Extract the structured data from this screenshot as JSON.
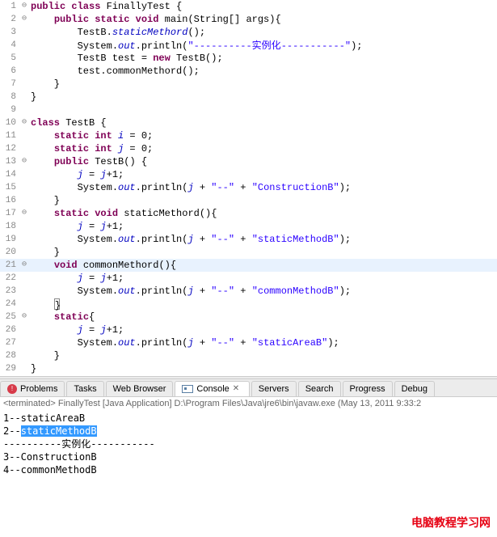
{
  "code": {
    "lines": [
      {
        "n": "1",
        "fold": "⊖",
        "tokens": [
          {
            "t": "kw",
            "v": "public class"
          },
          {
            "t": "",
            "v": " FinallyTest {"
          }
        ]
      },
      {
        "n": "2",
        "fold": "⊖",
        "tokens": [
          {
            "t": "",
            "v": "    "
          },
          {
            "t": "kw",
            "v": "public static void"
          },
          {
            "t": "",
            "v": " main(String[] args){"
          }
        ]
      },
      {
        "n": "3",
        "fold": "",
        "tokens": [
          {
            "t": "",
            "v": "        TestB."
          },
          {
            "t": "fld",
            "v": "staticMethord"
          },
          {
            "t": "",
            "v": "();"
          }
        ]
      },
      {
        "n": "4",
        "fold": "",
        "tokens": [
          {
            "t": "",
            "v": "        System."
          },
          {
            "t": "fld",
            "v": "out"
          },
          {
            "t": "",
            "v": ".println("
          },
          {
            "t": "str",
            "v": "\"----------"
          },
          {
            "t": "str-cn",
            "v": "实例化"
          },
          {
            "t": "str",
            "v": "-----------\""
          },
          {
            "t": "",
            "v": ");"
          }
        ]
      },
      {
        "n": "5",
        "fold": "",
        "tokens": [
          {
            "t": "",
            "v": "        TestB test = "
          },
          {
            "t": "kw",
            "v": "new"
          },
          {
            "t": "",
            "v": " TestB();"
          }
        ]
      },
      {
        "n": "6",
        "fold": "",
        "tokens": [
          {
            "t": "",
            "v": "        test.commonMethord();"
          }
        ]
      },
      {
        "n": "7",
        "fold": "",
        "tokens": [
          {
            "t": "",
            "v": "    }"
          }
        ]
      },
      {
        "n": "8",
        "fold": "",
        "tokens": [
          {
            "t": "",
            "v": "}"
          }
        ]
      },
      {
        "n": "9",
        "fold": "",
        "tokens": []
      },
      {
        "n": "10",
        "fold": "⊖",
        "tokens": [
          {
            "t": "kw",
            "v": "class"
          },
          {
            "t": "",
            "v": " TestB {"
          }
        ]
      },
      {
        "n": "11",
        "fold": "",
        "tokens": [
          {
            "t": "",
            "v": "    "
          },
          {
            "t": "kw",
            "v": "static int"
          },
          {
            "t": "",
            "v": " "
          },
          {
            "t": "fld",
            "v": "i"
          },
          {
            "t": "",
            "v": " = 0;"
          }
        ]
      },
      {
        "n": "12",
        "fold": "",
        "tokens": [
          {
            "t": "",
            "v": "    "
          },
          {
            "t": "kw",
            "v": "static int"
          },
          {
            "t": "",
            "v": " "
          },
          {
            "t": "fld",
            "v": "j"
          },
          {
            "t": "",
            "v": " = 0;"
          }
        ]
      },
      {
        "n": "13",
        "fold": "⊖",
        "tokens": [
          {
            "t": "",
            "v": "    "
          },
          {
            "t": "kw",
            "v": "public"
          },
          {
            "t": "",
            "v": " TestB() {"
          }
        ]
      },
      {
        "n": "14",
        "fold": "",
        "tokens": [
          {
            "t": "",
            "v": "        "
          },
          {
            "t": "fld",
            "v": "j"
          },
          {
            "t": "",
            "v": " = "
          },
          {
            "t": "fld",
            "v": "j"
          },
          {
            "t": "",
            "v": "+1;"
          }
        ]
      },
      {
        "n": "15",
        "fold": "",
        "tokens": [
          {
            "t": "",
            "v": "        System."
          },
          {
            "t": "fld",
            "v": "out"
          },
          {
            "t": "",
            "v": ".println("
          },
          {
            "t": "fld",
            "v": "j"
          },
          {
            "t": "",
            "v": " + "
          },
          {
            "t": "str",
            "v": "\"--\""
          },
          {
            "t": "",
            "v": " + "
          },
          {
            "t": "str",
            "v": "\"ConstructionB\""
          },
          {
            "t": "",
            "v": ");"
          }
        ]
      },
      {
        "n": "16",
        "fold": "",
        "tokens": [
          {
            "t": "",
            "v": "    }"
          }
        ]
      },
      {
        "n": "17",
        "fold": "⊖",
        "tokens": [
          {
            "t": "",
            "v": "    "
          },
          {
            "t": "kw",
            "v": "static void"
          },
          {
            "t": "",
            "v": " staticMethord(){"
          }
        ]
      },
      {
        "n": "18",
        "fold": "",
        "tokens": [
          {
            "t": "",
            "v": "        "
          },
          {
            "t": "fld",
            "v": "j"
          },
          {
            "t": "",
            "v": " = "
          },
          {
            "t": "fld",
            "v": "j"
          },
          {
            "t": "",
            "v": "+1;"
          }
        ]
      },
      {
        "n": "19",
        "fold": "",
        "tokens": [
          {
            "t": "",
            "v": "        System."
          },
          {
            "t": "fld",
            "v": "out"
          },
          {
            "t": "",
            "v": ".println("
          },
          {
            "t": "fld",
            "v": "j"
          },
          {
            "t": "",
            "v": " + "
          },
          {
            "t": "str",
            "v": "\"--\""
          },
          {
            "t": "",
            "v": " + "
          },
          {
            "t": "str",
            "v": "\"staticMethodB\""
          },
          {
            "t": "",
            "v": ");"
          }
        ]
      },
      {
        "n": "20",
        "fold": "",
        "tokens": [
          {
            "t": "",
            "v": "    }"
          }
        ]
      },
      {
        "n": "21",
        "fold": "⊖",
        "hl": true,
        "tokens": [
          {
            "t": "",
            "v": "    "
          },
          {
            "t": "kw",
            "v": "void"
          },
          {
            "t": "",
            "v": " commonMethord(){"
          }
        ]
      },
      {
        "n": "22",
        "fold": "",
        "tokens": [
          {
            "t": "",
            "v": "        "
          },
          {
            "t": "fld",
            "v": "j"
          },
          {
            "t": "",
            "v": " = "
          },
          {
            "t": "fld",
            "v": "j"
          },
          {
            "t": "",
            "v": "+1;"
          }
        ]
      },
      {
        "n": "23",
        "fold": "",
        "tokens": [
          {
            "t": "",
            "v": "        System."
          },
          {
            "t": "fld",
            "v": "out"
          },
          {
            "t": "",
            "v": ".println("
          },
          {
            "t": "fld",
            "v": "j"
          },
          {
            "t": "",
            "v": " + "
          },
          {
            "t": "str",
            "v": "\"--\""
          },
          {
            "t": "",
            "v": " + "
          },
          {
            "t": "str",
            "v": "\"commonMethodB\""
          },
          {
            "t": "",
            "v": ");"
          }
        ]
      },
      {
        "n": "24",
        "fold": "",
        "tokens": [
          {
            "t": "",
            "v": "    "
          },
          {
            "t": "cursor",
            "v": "}"
          }
        ]
      },
      {
        "n": "25",
        "fold": "⊖",
        "tokens": [
          {
            "t": "",
            "v": "    "
          },
          {
            "t": "kw",
            "v": "static"
          },
          {
            "t": "",
            "v": "{"
          }
        ]
      },
      {
        "n": "26",
        "fold": "",
        "tokens": [
          {
            "t": "",
            "v": "        "
          },
          {
            "t": "fld",
            "v": "j"
          },
          {
            "t": "",
            "v": " = "
          },
          {
            "t": "fld",
            "v": "j"
          },
          {
            "t": "",
            "v": "+1;"
          }
        ]
      },
      {
        "n": "27",
        "fold": "",
        "tokens": [
          {
            "t": "",
            "v": "        System."
          },
          {
            "t": "fld",
            "v": "out"
          },
          {
            "t": "",
            "v": ".println("
          },
          {
            "t": "fld",
            "v": "j"
          },
          {
            "t": "",
            "v": " + "
          },
          {
            "t": "str",
            "v": "\"--\""
          },
          {
            "t": "",
            "v": " + "
          },
          {
            "t": "str",
            "v": "\"staticAreaB\""
          },
          {
            "t": "",
            "v": ");"
          }
        ]
      },
      {
        "n": "28",
        "fold": "",
        "tokens": [
          {
            "t": "",
            "v": "    }"
          }
        ]
      },
      {
        "n": "29",
        "fold": "",
        "tokens": [
          {
            "t": "",
            "v": "}"
          }
        ]
      }
    ]
  },
  "tabs": {
    "problems": "Problems",
    "tasks": "Tasks",
    "webbrowser": "Web Browser",
    "console": "Console",
    "servers": "Servers",
    "search": "Search",
    "progress": "Progress",
    "debug": "Debug",
    "close_x": "✕"
  },
  "console": {
    "header_prefix": "<terminated> FinallyTest [Java Application] D:\\Program Files\\Java\\jre6\\bin\\javaw.exe (May 13, 2011 9:33:2",
    "lines": [
      {
        "pre": "1--staticAreaB",
        "sel": "",
        "post": ""
      },
      {
        "pre": "2--",
        "sel": "staticMethodB",
        "post": ""
      },
      {
        "pre": "----------",
        "sel": "",
        "post": "",
        "cn": "实例化",
        "post2": "-----------"
      },
      {
        "pre": "3--ConstructionB",
        "sel": "",
        "post": ""
      },
      {
        "pre": "4--commonMethodB",
        "sel": "",
        "post": ""
      }
    ]
  },
  "watermark": "电脑教程学习网"
}
